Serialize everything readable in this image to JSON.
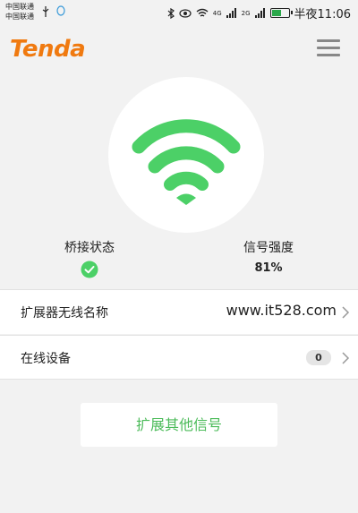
{
  "status_bar": {
    "carrier_1": "中国联通",
    "carrier_2": "中国联通",
    "net_1": "4G",
    "net_2": "2G",
    "time": "半夜11:06"
  },
  "header": {
    "logo": "Tenda",
    "menu_icon": "hamburger-menu-icon"
  },
  "status": {
    "bridge_label": "桥接状态",
    "bridge_icon": "check-circle-icon",
    "signal_label": "信号强度",
    "signal_value": "81%"
  },
  "wireless_name": {
    "label": "扩展器无线名称",
    "value": "www.it528.com"
  },
  "online_devices": {
    "label": "在线设备",
    "count": "0"
  },
  "extend_button": {
    "label": "扩展其他信号"
  },
  "colors": {
    "brand": "#f07a10",
    "accent_green": "#4cd067"
  }
}
